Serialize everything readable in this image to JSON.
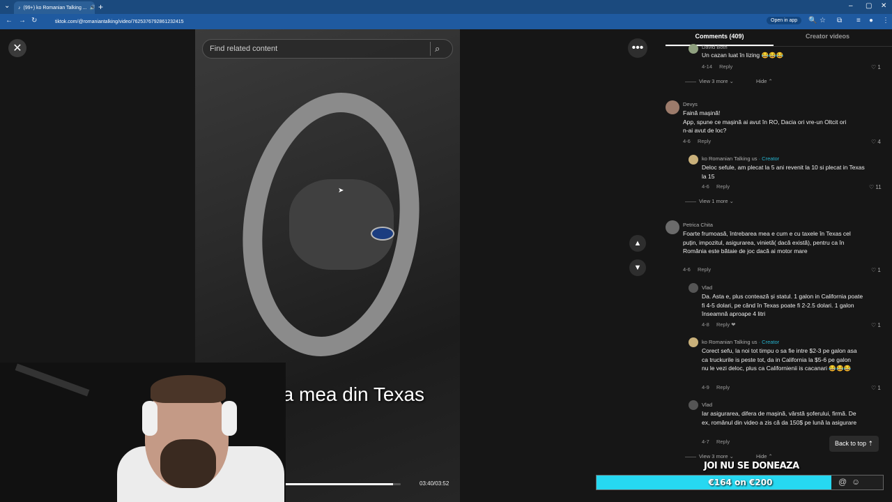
{
  "browser": {
    "tab_title": "(99+) ko Romanian Talking ...",
    "tab_close": "✕",
    "new_tab": "+",
    "url": "tiktok.com/@romaniantalking/video/7625376792861232415",
    "open_in_app": "Open in app",
    "minimize": "–",
    "maximize": "▢",
    "close": "✕"
  },
  "video": {
    "search_placeholder": "Find related content",
    "caption": "Masina mea din Texas",
    "time": "03:40/03:52",
    "progress_fraction": 0.94
  },
  "panel": {
    "tab_comments": "Comments (409)",
    "tab_creator": "Creator videos",
    "comments": [
      {
        "user": "David Both",
        "text": "Un cazan luat în lizing 😂😂😂",
        "date": "4-14",
        "reply": "Reply",
        "likes": "1"
      },
      {
        "view_more": "View 3 more",
        "hide": "Hide"
      },
      {
        "user": "Devys",
        "text": "Faină mașină!\nApp, spune ce mașină ai avut în RO, Dacia ori vre-un Oltcit ori n-ai avut de loc?",
        "date": "4-6",
        "reply": "Reply",
        "likes": "4"
      },
      {
        "user": "ko Romanian Talking us",
        "creator": "· Creator",
        "text": "Deloc sefule, am plecat la 5 ani revenit la 10 si plecat in Texas la 15",
        "date": "4-6",
        "reply": "Reply",
        "likes": "11"
      },
      {
        "view_more": "View 1 more"
      },
      {
        "user": "Petrica Chita",
        "text": "Foarte frumoasă, întrebarea mea e cum e cu taxele în Texas cel puțin, impozitul, asigurarea, vinietă( dacă există), pentru ca în România este bătaie de joc dacă ai motor mare",
        "date": "4-6",
        "reply": "Reply",
        "likes": "1"
      },
      {
        "user": "Vlad",
        "text": "Da. Asta e, plus contează și statul. 1 galon in California poate fi 4-5 dolari, pe când în Texas poate fi 2-2.5 dolari. 1 galon înseamnă aproape 4 litri",
        "date": "4-8",
        "reply": "Reply",
        "likes": "1"
      },
      {
        "user": "ko Romanian Talking us",
        "creator": "· Creator",
        "text": "Corect sefu, la noi tot timpu o sa fie intre $2-3 pe galon asa ca truckurile is peste tot, da in California la $5-6 pe galon nu le vezi deloc, plus ca Californienii is cacanari 😂😂😂",
        "date": "4-9",
        "reply": "Reply",
        "likes": "1"
      },
      {
        "user": "Vlad",
        "text": "Iar asigurarea, difera de mașină, vârstă șoferului, firmă. De ex, românul din video a zis că da 150$ pe lună la asigurare",
        "date": "4-7",
        "reply": "Reply"
      },
      {
        "view_more": "View 3 more",
        "hide": "Hide"
      }
    ],
    "back_to_top": "Back to top"
  },
  "overlay": {
    "donate_title": "JOI NU SE DONEAZA",
    "donate_amount": "€164 on €200",
    "donate_fraction": 0.82
  },
  "colors": {
    "accent": "#26d8f1",
    "creator": "#25b3ce",
    "browser": "#1f5aa0"
  }
}
